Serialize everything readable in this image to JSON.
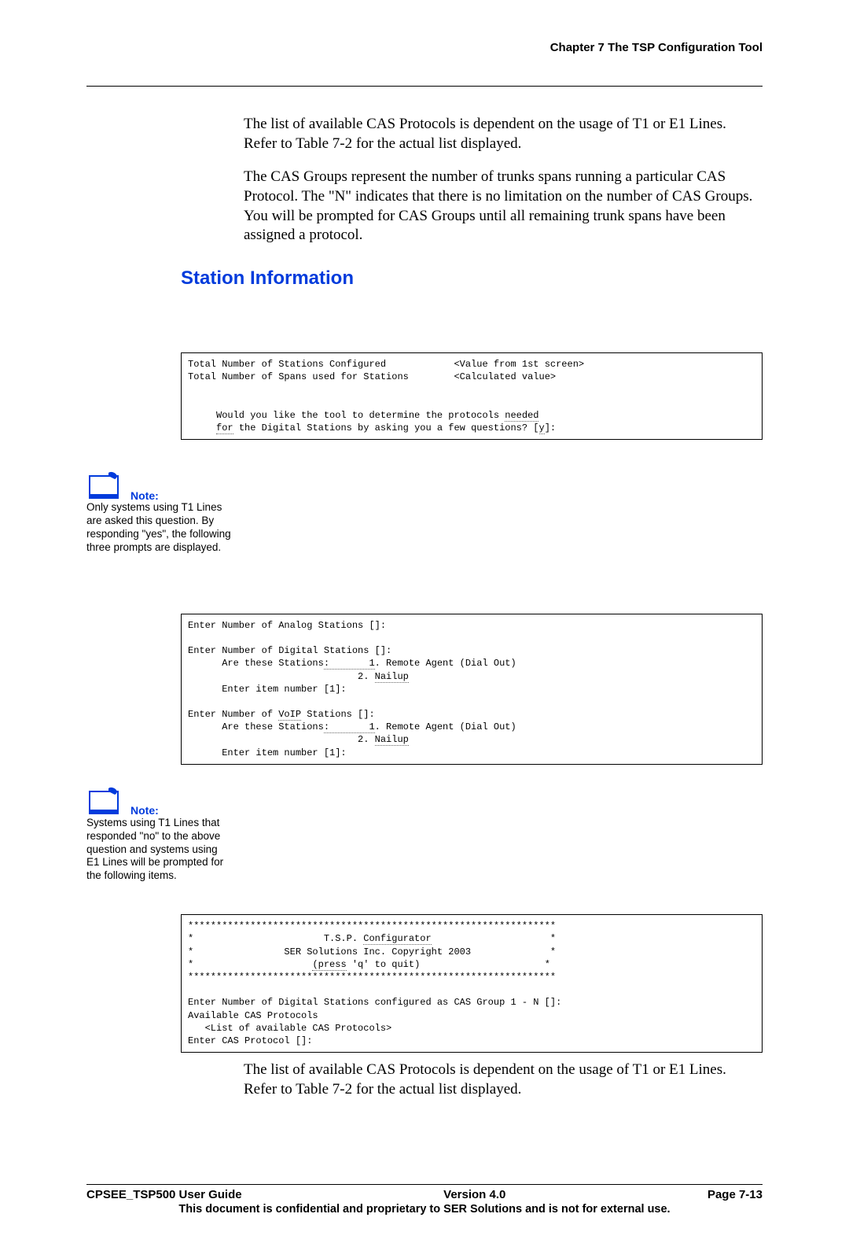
{
  "header": {
    "chapter": "Chapter 7 The TSP Configuration Tool"
  },
  "paragraphs": {
    "p1": "The list of available CAS Protocols is dependent on the usage of T1 or E1 Lines.  Refer to Table 7-2 for the actual list displayed.",
    "p2": "The CAS Groups represent the number of trunks spans running a particular CAS Protocol. The \"N\" indicates that there is no limitation on the number of CAS Groups. You will be prompted for CAS Groups until all remaining trunk spans have been assigned a protocol.",
    "p3": "The list of available CAS Protocols is dependent on the usage of T1 or E1 Lines.  Refer to Table 7-2 for the actual list displayed."
  },
  "section_heading": "Station Information",
  "terminal1": {
    "l1a": "Total Number of Stations Configured",
    "l1b": "<Value from 1st screen>",
    "l2a": "Total Number of Spans used for Stations",
    "l2b": "<Calculated value>",
    "q1": "     Would you like the tool to determine the protocols ",
    "q1u": "needed",
    "q2a": "     ",
    "q2u": "for",
    "q2b": " the Digital Stations by asking you a few questions? [",
    "q2c": "y",
    "q2d": "]:"
  },
  "note1": {
    "label": "Note:",
    "text": "Only systems using T1 Lines are asked this question.  By responding \"yes\", the following three prompts are displayed."
  },
  "terminal2": {
    "l1": "Enter Number of Analog Stations []:",
    "l2": "Enter Number of Digital Stations []:",
    "l3a": "      Are these Stations",
    "l3u": ":       1",
    "l3b": ". Remote Agent (Dial Out)",
    "l4a": "                              2. ",
    "l4u": "Nailup",
    "l5": "      Enter item number [1]:",
    "l6a": "Enter Number of ",
    "l6u": "VoIP",
    "l6b": " Stations []:",
    "l7a": "      Are these Stations",
    "l7u": ":       1",
    "l7b": ". Remote Agent (Dial Out)",
    "l8a": "                              2. ",
    "l8u": "Nailup",
    "l9": "      Enter item number [1]:"
  },
  "note2": {
    "label": "Note:",
    "text": "Systems using T1 Lines that responded \"no\" to the above question and systems using E1 Lines will be prompted for the following items."
  },
  "terminal3": {
    "stars": "*****************************************************************",
    "r1a": "*                       T.S.P. ",
    "r1u": "Configurator",
    "r1b": "                     *",
    "r2": "*                SER Solutions Inc. Copyright 2003              *",
    "r3a": "*                     ",
    "r3u": "(press",
    "r3b": " 'q' to quit)                      *",
    "l1": "Enter Number of Digital Stations configured as CAS Group 1 - N []:",
    "l2": "Available CAS Protocols",
    "l3": "   <List of available CAS Protocols>",
    "l4": "Enter CAS Protocol []:"
  },
  "footer": {
    "left": "CPSEE_TSP500 User Guide",
    "center": "Version 4.0",
    "right": "Page 7-13",
    "confidential": "This document is confidential and proprietary to SER Solutions and is not for external use."
  }
}
